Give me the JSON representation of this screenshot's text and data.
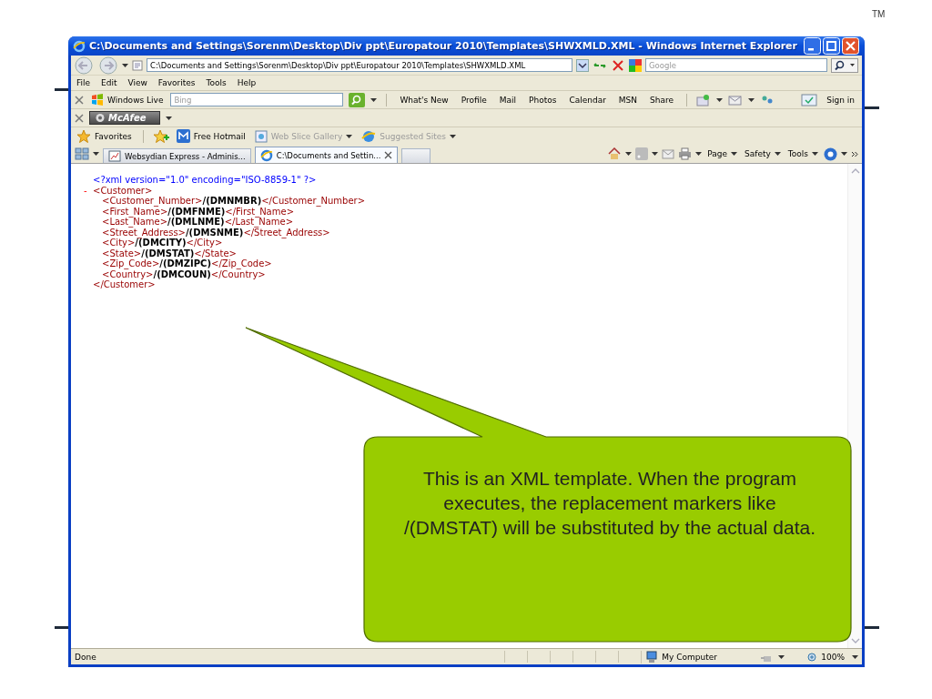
{
  "slide": {
    "trademark": "TM"
  },
  "window": {
    "title": "C:\\Documents and Settings\\Sorenm\\Desktop\\Div ppt\\Europatour 2010\\Templates\\SHWXMLD.XML - Windows Internet Explorer"
  },
  "address_bar": {
    "value": "C:\\Documents and Settings\\Sorenm\\Desktop\\Div ppt\\Europatour 2010\\Templates\\SHWXMLD.XML",
    "search_placeholder": "Google"
  },
  "menu": [
    "File",
    "Edit",
    "View",
    "Favorites",
    "Tools",
    "Help"
  ],
  "live_toolbar": {
    "brand": "Windows Live",
    "search_placeholder": "Bing",
    "links": [
      "What's New",
      "Profile",
      "Mail",
      "Photos",
      "Calendar",
      "MSN",
      "Share"
    ],
    "sign_in": "Sign in"
  },
  "mcafee_toolbar": {
    "label": "McAfee"
  },
  "favorites_bar": {
    "label": "Favorites",
    "items": [
      {
        "label": "Free Hotmail",
        "disabled": false,
        "dropdown": false
      },
      {
        "label": "Web Slice Gallery",
        "disabled": true,
        "dropdown": true
      },
      {
        "label": "Suggested Sites",
        "disabled": true,
        "dropdown": true
      }
    ]
  },
  "tabs": [
    {
      "label": "Websydian Express - Adminis...",
      "selected": false
    },
    {
      "label": "C:\\Documents and Settin...",
      "selected": true
    }
  ],
  "command_bar": [
    "Page",
    "Safety",
    "Tools"
  ],
  "xml_lines": [
    {
      "kind": "pi",
      "text": "<?xml version=\"1.0\" encoding=\"ISO-8859-1\" ?>"
    },
    {
      "kind": "open",
      "toggle": "-",
      "text": "<Customer>"
    },
    {
      "kind": "element",
      "open": "<Customer_Number>",
      "value": "/(DMNMBR)",
      "close": "</Customer_Number>"
    },
    {
      "kind": "element",
      "open": "<First_Name>",
      "value": "/(DMFNME)",
      "close": "</First_Name>"
    },
    {
      "kind": "element",
      "open": "<Last_Name>",
      "value": "/(DMLNME)",
      "close": "</Last_Name>"
    },
    {
      "kind": "element",
      "open": "<Street_Address>",
      "value": "/(DMSNME)",
      "close": "</Street_Address>"
    },
    {
      "kind": "element",
      "open": "<City>",
      "value": "/(DMCITY)",
      "close": "</City>"
    },
    {
      "kind": "element",
      "open": "<State>",
      "value": "/(DMSTAT)",
      "close": "</State>"
    },
    {
      "kind": "element",
      "open": "<Zip_Code>",
      "value": "/(DMZIPC)",
      "close": "</Zip_Code>"
    },
    {
      "kind": "element",
      "open": "<Country>",
      "value": "/(DMCOUN)",
      "close": "</Country>"
    },
    {
      "kind": "close",
      "text": "</Customer>"
    }
  ],
  "status_bar": {
    "text": "Done",
    "zone": "My Computer",
    "zoom": "100%"
  },
  "callout": {
    "text": "This is an XML template. When the program executes, the replacement markers like /(DMSTAT) will be substituted by the actual data."
  }
}
